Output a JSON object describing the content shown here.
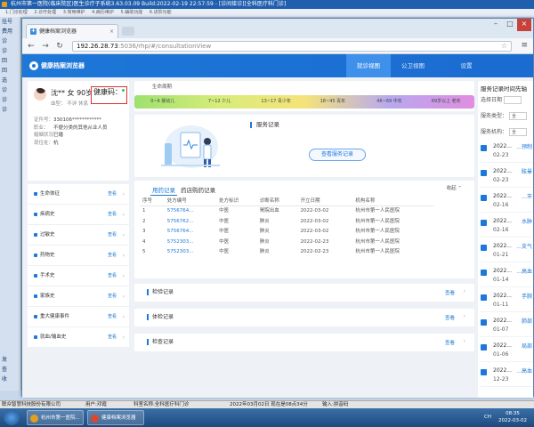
{
  "outer": {
    "title": "杭州市第一医院(临床院区)医生诊疗子系统3.63.03.09  Build:2022-02-19 22:57:59 - [诊间接诊][全科医疗科门诊]",
    "menu": [
      "1.门诊处理",
      "2.诊疗处理",
      "3.常用维护",
      "4.病历维护",
      "5.辅助功能",
      "6.进阶功能"
    ],
    "left_items": [
      "挂号",
      "费用",
      "诊",
      "诊",
      "回",
      "回",
      "选",
      "诊",
      "诊",
      "诊"
    ],
    "bottom_items": [
      "发",
      "查",
      "收"
    ]
  },
  "browser": {
    "tab_title": "健康档案浏览器",
    "url_host": "192.26.28.73",
    "url_rest": ":5036/rhp/#/consultationView"
  },
  "app": {
    "logo": "健康档案浏览器",
    "nav": [
      "就诊视图",
      "公卫视图",
      "设置"
    ],
    "patient": {
      "name": "沈** 女 90岁",
      "blood": "血型： 不详 休息",
      "health_box": "健康码：",
      "info": [
        {
          "k": "证件号：",
          "v": "330106************"
        },
        {
          "k": "职业：",
          "v": "不便分类的其他从业人员"
        },
        {
          "k": "婚姻状况：",
          "v": "已婚"
        },
        {
          "k": "现住址：",
          "v": "杭"
        }
      ]
    },
    "categories": [
      {
        "label": "生命体征",
        "view": "查看"
      },
      {
        "label": "疾病史",
        "view": "查看"
      },
      {
        "label": "过敏史",
        "view": "查看"
      },
      {
        "label": "药物史",
        "view": "查看"
      },
      {
        "label": "手术史",
        "view": "查看"
      },
      {
        "label": "家族史",
        "view": "查看"
      },
      {
        "label": "重大健康事件",
        "view": "查看"
      },
      {
        "label": "就血/输血史",
        "view": "查看"
      }
    ],
    "life_stages": {
      "title": "生命周期",
      "stages": [
        "0~6 婴幼儿",
        "7~12 少儿",
        "13~17 青少年",
        "18~45 青年",
        "46~69 中年",
        "69岁以上 老年"
      ]
    },
    "service": {
      "title": "服务记录",
      "button": "查看服务记录"
    },
    "records": {
      "tabs": [
        "用药记录",
        "药店购药记录"
      ],
      "collapse": "收起",
      "columns": [
        "序号",
        "处方编号",
        "处方标识",
        "诊断名称",
        "开立日期",
        "机构名称"
      ],
      "rows": [
        [
          "1",
          "5756764...",
          "中医",
          "胃脘出血",
          "2022-03-02",
          "杭州市第一人民医院"
        ],
        [
          "2",
          "5756762...",
          "中医",
          "肺炎",
          "2022-03-02",
          "杭州市第一人民医院"
        ],
        [
          "3",
          "5756764...",
          "中医",
          "肺炎",
          "2022-03-02",
          "杭州市第一人民医院"
        ],
        [
          "4",
          "5752303...",
          "中医",
          "肺炎",
          "2022-02-23",
          "杭州市第一人民医院"
        ],
        [
          "5",
          "5752303...",
          "中医",
          "肺炎",
          "2022-02-23",
          "杭州市第一人民医院"
        ]
      ]
    },
    "panels": [
      {
        "title": "检验记录",
        "view": "查看"
      },
      {
        "title": "体检记录",
        "view": "查看"
      },
      {
        "title": "检查记录",
        "view": "查看"
      }
    ],
    "right": {
      "title": "服务记录时间先轴",
      "filters": [
        {
          "label": "选择日期",
          "value": ""
        },
        {
          "label": "服务类型：",
          "value": "全"
        },
        {
          "label": "服务机构：",
          "value": "全"
        }
      ],
      "items": [
        {
          "t": "2022...",
          "d": "02-23",
          "n": "...预制"
        },
        {
          "t": "2022...",
          "d": "02-23",
          "n": "眩晕"
        },
        {
          "t": "2022...",
          "d": "02-16",
          "n": "...市"
        },
        {
          "t": "2022...",
          "d": "02-16",
          "n": "水肿"
        },
        {
          "t": "2022...",
          "d": "01-21",
          "n": "...支气"
        },
        {
          "t": "2022...",
          "d": "01-14",
          "n": "...高血"
        },
        {
          "t": "2022...",
          "d": "01-11",
          "n": "手腕"
        },
        {
          "t": "2022...",
          "d": "01-07",
          "n": "肺部"
        },
        {
          "t": "2022...",
          "d": "01-06",
          "n": "局部"
        },
        {
          "t": "2022...",
          "d": "12-23",
          "n": "...高血"
        }
      ]
    }
  },
  "statusbar": {
    "company": "联众智慧科技股份有限公司",
    "user": "用户:邓霞",
    "dept": "科室名称:全科医疗科门诊",
    "date": "2022年03月02日  现在是08点34分",
    "input": "输入:拼音码"
  },
  "taskbar": {
    "tasks": [
      "杭州市第一医院...",
      "健康档案浏览器"
    ],
    "tray": "CH",
    "time": "08:35",
    "date": "2022-03-02"
  }
}
